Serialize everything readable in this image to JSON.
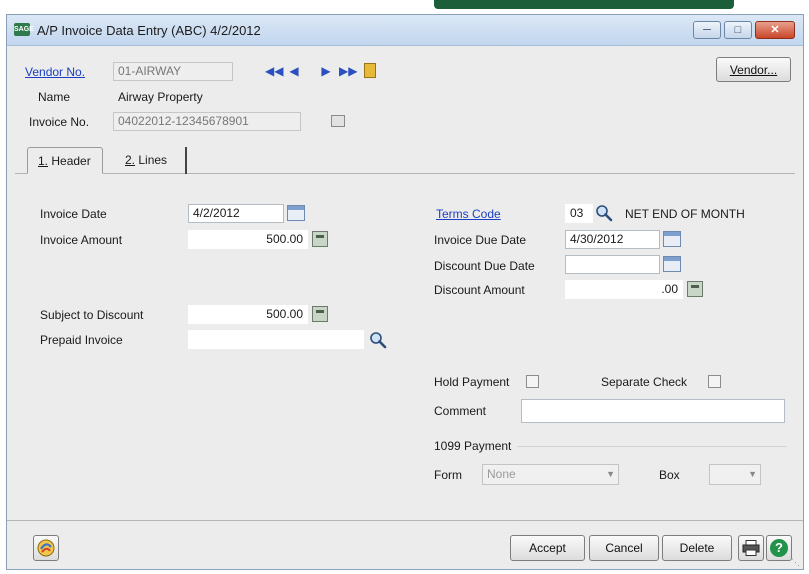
{
  "window": {
    "title": "A/P Invoice Data Entry (ABC) 4/2/2012",
    "app_badge": "SAGE",
    "minimize_icon": "minimize-icon",
    "restore_icon": "restore-icon",
    "close_icon": "close-icon"
  },
  "vendor": {
    "label": "Vendor No.",
    "value": "01-AIRWAY",
    "button_label": "Vendor...",
    "name_label": "Name",
    "name_value": "Airway Property"
  },
  "invoice": {
    "label": "Invoice No.",
    "value": "04022012-12345678901"
  },
  "tabs": [
    {
      "label": "Header",
      "number": "1."
    },
    {
      "label": "Lines",
      "number": "2."
    }
  ],
  "header": {
    "invoice_date_label": "Invoice Date",
    "invoice_date": "4/2/2012",
    "invoice_amount_label": "Invoice Amount",
    "invoice_amount": "500.00",
    "subject_discount_label": "Subject to Discount",
    "subject_discount": "500.00",
    "prepaid_label": "Prepaid Invoice",
    "prepaid_value": "",
    "terms_label": "Terms Code",
    "terms_code": "03",
    "terms_desc": "NET END OF MONTH",
    "due_date_label": "Invoice Due Date",
    "due_date": "4/30/2012",
    "discount_due_label": "Discount Due Date",
    "discount_due": "",
    "discount_amount_label": "Discount Amount",
    "discount_amount": ".00",
    "hold_label": "Hold Payment",
    "separate_label": "Separate Check",
    "comment_label": "Comment",
    "comment_value": "",
    "payment_1099_label": "1099 Payment",
    "form_label": "Form",
    "form_value": "None",
    "box_label": "Box",
    "box_value": ""
  },
  "footer": {
    "accept": "Accept",
    "cancel": "Cancel",
    "delete": "Delete"
  }
}
